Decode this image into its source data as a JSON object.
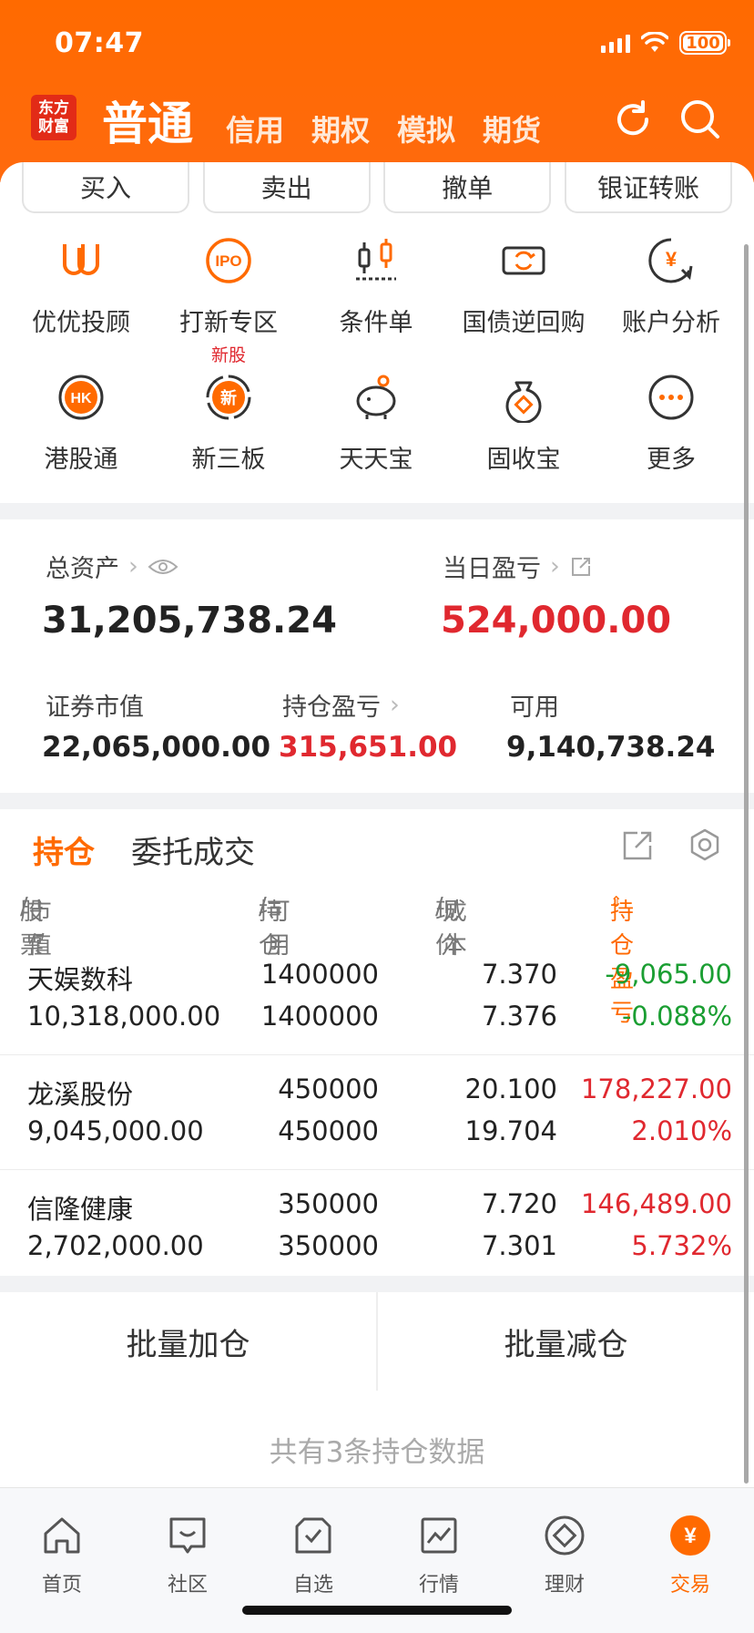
{
  "status": {
    "time": "07:47",
    "battery": "100"
  },
  "header": {
    "logo": "东方财富",
    "main_tab": "普通",
    "tabs": [
      "信用",
      "期权",
      "模拟",
      "期货"
    ]
  },
  "actions": [
    "买入",
    "卖出",
    "撤单",
    "银证转账"
  ],
  "grid": [
    {
      "label": "优优投顾",
      "icon": "uu-advisor-icon"
    },
    {
      "label": "打新专区",
      "icon": "ipo-icon",
      "sub": "新股"
    },
    {
      "label": "条件单",
      "icon": "conditional-order-icon"
    },
    {
      "label": "国债逆回购",
      "icon": "repo-icon"
    },
    {
      "label": "账户分析",
      "icon": "account-analysis-icon"
    },
    {
      "label": "港股通",
      "icon": "hk-connect-icon"
    },
    {
      "label": "新三板",
      "icon": "neeq-icon"
    },
    {
      "label": "天天宝",
      "icon": "piggy-bank-icon"
    },
    {
      "label": "固收宝",
      "icon": "fixed-income-icon"
    },
    {
      "label": "更多",
      "icon": "more-icon"
    }
  ],
  "ipo_icon_text": "IPO",
  "hk_icon_text": "HK",
  "neeq_icon_text": "新",
  "assets": {
    "total_label": "总资产",
    "total_value": "31,205,738.24",
    "daily_label": "当日盈亏",
    "daily_value": "524,000.00",
    "market_label": "证券市值",
    "market_value": "22,065,000.00",
    "position_pl_label": "持仓盈亏",
    "position_pl_value": "315,651.00",
    "available_label": "可用",
    "available_value": "9,140,738.24"
  },
  "positions": {
    "tab_active": "持仓",
    "tab_other": "委托成交",
    "headers": {
      "stock": "股票",
      "stock_sub": "市值",
      "hold": "持仓",
      "hold_sub": "可用",
      "price": "现价",
      "price_sub": "成本",
      "pl": "持仓盈亏"
    },
    "rows": [
      {
        "name": "天娱数科",
        "value": "10,318,000.00",
        "hold": "1400000",
        "avail": "1400000",
        "price": "7.370",
        "cost": "7.376",
        "pl": "-9,065.00",
        "pl_pct": "-0.088%",
        "trend": "down"
      },
      {
        "name": "龙溪股份",
        "value": "9,045,000.00",
        "hold": "450000",
        "avail": "450000",
        "price": "20.100",
        "cost": "19.704",
        "pl": "178,227.00",
        "pl_pct": "2.010%",
        "trend": "up"
      },
      {
        "name": "信隆健康",
        "value": "2,702,000.00",
        "hold": "350000",
        "avail": "350000",
        "price": "7.720",
        "cost": "7.301",
        "pl": "146,489.00",
        "pl_pct": "5.732%",
        "trend": "up"
      }
    ],
    "bulk_add": "批量加仓",
    "bulk_reduce": "批量减仓",
    "count_text": "共有3条持仓数据"
  },
  "tabbar": [
    {
      "label": "首页",
      "icon": "home-icon"
    },
    {
      "label": "社区",
      "icon": "community-icon"
    },
    {
      "label": "自选",
      "icon": "watchlist-icon"
    },
    {
      "label": "行情",
      "icon": "market-icon"
    },
    {
      "label": "理财",
      "icon": "wealth-icon"
    },
    {
      "label": "交易",
      "icon": "trade-icon",
      "active": true
    }
  ],
  "colors": {
    "brand": "#ff6a00",
    "up": "#e0282f",
    "down": "#1a9e32"
  }
}
